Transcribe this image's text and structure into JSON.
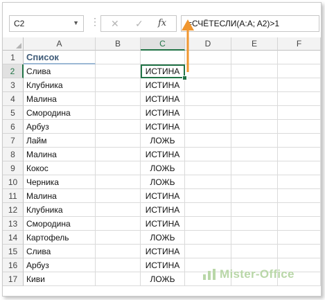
{
  "formula_bar": {
    "name_box": "C2",
    "formula": "=СЧЁТЕСЛИ(A:A; A2)>1",
    "cancel_icon": "close-icon",
    "enter_icon": "check-icon",
    "function_icon": "fx"
  },
  "columns": [
    "A",
    "B",
    "C",
    "D",
    "E",
    "F"
  ],
  "rows": [
    {
      "num": "1",
      "a": "Список",
      "c": ""
    },
    {
      "num": "2",
      "a": "Слива",
      "c": "ИСТИНА"
    },
    {
      "num": "3",
      "a": "Клубника",
      "c": "ИСТИНА"
    },
    {
      "num": "4",
      "a": "Малина",
      "c": "ИСТИНА"
    },
    {
      "num": "5",
      "a": "Смородина",
      "c": "ИСТИНА"
    },
    {
      "num": "6",
      "a": "Арбуз",
      "c": "ИСТИНА"
    },
    {
      "num": "7",
      "a": "Лайм",
      "c": "ЛОЖЬ"
    },
    {
      "num": "8",
      "a": "Малина",
      "c": "ИСТИНА"
    },
    {
      "num": "9",
      "a": "Кокос",
      "c": "ЛОЖЬ"
    },
    {
      "num": "10",
      "a": "Черника",
      "c": "ЛОЖЬ"
    },
    {
      "num": "11",
      "a": "Малина",
      "c": "ИСТИНА"
    },
    {
      "num": "12",
      "a": "Клубника",
      "c": "ИСТИНА"
    },
    {
      "num": "13",
      "a": "Смородина",
      "c": "ИСТИНА"
    },
    {
      "num": "14",
      "a": "Картофель",
      "c": "ЛОЖЬ"
    },
    {
      "num": "15",
      "a": "Слива",
      "c": "ИСТИНА"
    },
    {
      "num": "16",
      "a": "Арбуз",
      "c": "ИСТИНА"
    },
    {
      "num": "17",
      "a": "Киви",
      "c": "ЛОЖЬ"
    }
  ],
  "selected_cell": "C2",
  "watermark": "Mister-Office",
  "colors": {
    "accent": "#217346",
    "arrow": "#f0962f",
    "header_text": "#3f5b78"
  }
}
